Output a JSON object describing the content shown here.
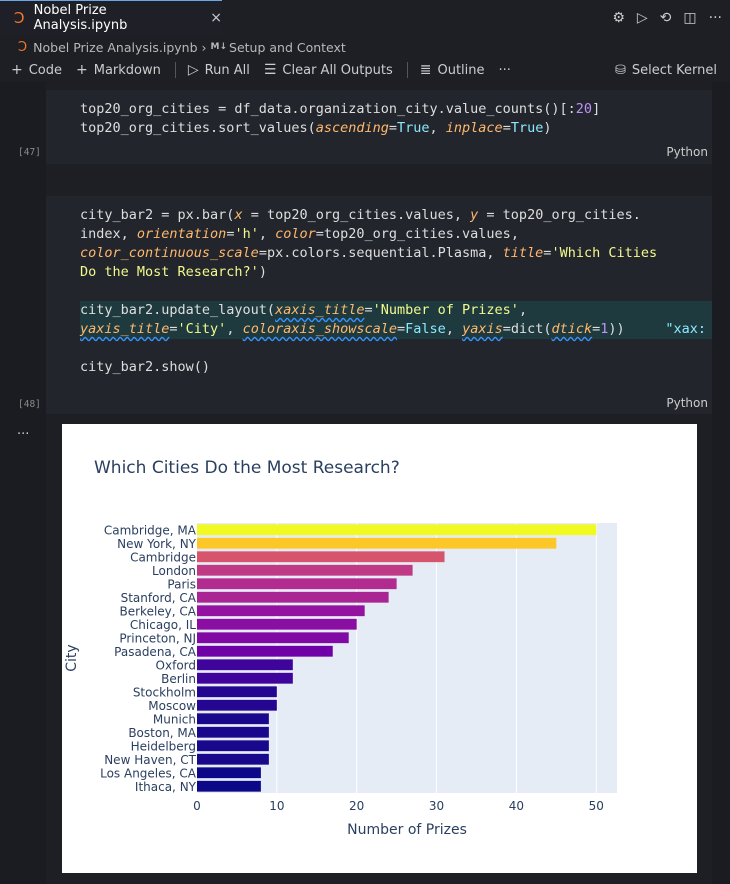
{
  "tab": {
    "title": "Nobel Prize Analysis.ipynb",
    "close": "×"
  },
  "breadcrumb": {
    "file": "Nobel Prize Analysis.ipynb",
    "md_badge": "M↓",
    "section": "Setup and Context"
  },
  "toolbar": {
    "code": "Code",
    "markdown": "Markdown",
    "run_all": "Run All",
    "clear_outputs": "Clear All Outputs",
    "outline": "Outline",
    "more": "···",
    "kernel": "Select Kernel"
  },
  "cell47": {
    "exec": "[47]",
    "lang": "Python"
  },
  "cell48": {
    "exec": "[48]",
    "lang": "Python"
  },
  "output_dots": "...",
  "colors": {
    "accent": "#3794ff",
    "jupyter": "#f37726",
    "plot_bg": "#e5ecf6"
  },
  "chart_data": {
    "type": "bar",
    "orientation": "h",
    "title": "Which Cities Do the Most Research?",
    "xlabel": "Number of Prizes",
    "ylabel": "City",
    "categories": [
      "Cambridge, MA",
      "New York, NY",
      "Cambridge",
      "London",
      "Paris",
      "Stanford, CA",
      "Berkeley, CA",
      "Chicago, IL",
      "Princeton, NJ",
      "Pasadena, CA",
      "Oxford",
      "Berlin",
      "Stockholm",
      "Moscow",
      "Munich",
      "Boston, MA",
      "Heidelberg",
      "New Haven, CT",
      "Los Angeles, CA",
      "Ithaca, NY"
    ],
    "values": [
      50,
      45,
      31,
      27,
      25,
      24,
      21,
      20,
      19,
      17,
      12,
      12,
      10,
      10,
      9,
      9,
      9,
      9,
      8,
      8
    ],
    "xlim": [
      0,
      52.6
    ],
    "xticks": [
      0,
      10,
      20,
      30,
      40,
      50
    ],
    "colorscale": "Plasma",
    "grid": true
  }
}
